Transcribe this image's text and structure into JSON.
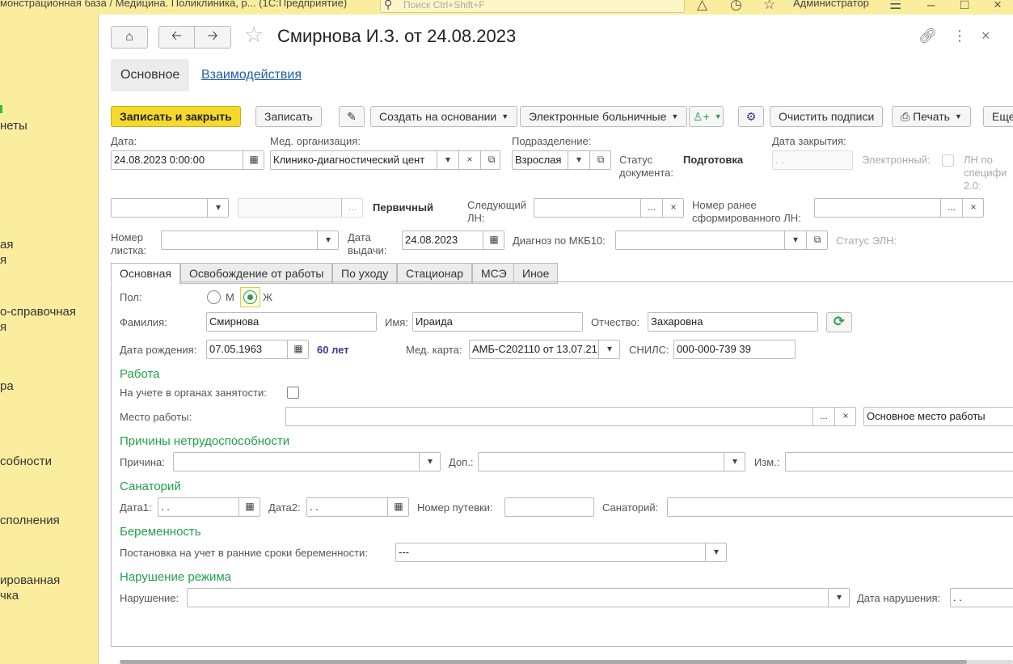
{
  "titlebar": {
    "app_title": "монстрационная база / Медицина. Поликлиника, р... (1С:Предприятие)",
    "search_placeholder": "Поиск Ctrl+Shift+F",
    "user": "Администратор"
  },
  "sidebar": {
    "items": [
      "неты",
      "ая\nя",
      "о-справочная\nя",
      "ра",
      "собности",
      "сполнения",
      "ированная\nчка"
    ]
  },
  "header": {
    "title": "Смирнова И.З. от 24.08.2023"
  },
  "page_tabs": [
    {
      "label": "Основное"
    },
    {
      "label": "Взаимодействия"
    }
  ],
  "toolbar": {
    "save_close": "Записать и закрыть",
    "save": "Записать",
    "create_based": "Создать на основании",
    "sick_leaves": "Электронные больничные",
    "clear_signatures": "Очистить подписи",
    "print": "Печать",
    "more": "Еще"
  },
  "top_fields": {
    "date_label": "Дата:",
    "date_value": "24.08.2023  0:00:00",
    "med_org_label": "Мед. организация:",
    "med_org_value": "Клинико-диагностический цент",
    "division_label": "Подразделение:",
    "division_value": "Взрослая",
    "doc_status_label": "Статус\nдокумента:",
    "doc_status_value": "Подготовка",
    "close_date_label": "Дата закрытия:",
    "close_date_value": " . .",
    "electronic_label": "Электронный:",
    "ln_spec_label": "ЛН по\nспецифи\n2.0:",
    "primary_text": "Первичный",
    "next_ln_label": "Следующий\nЛН:",
    "prev_number_label": "Номер ранее\nсформированного ЛН:",
    "sheet_number_label": "Номер\nлистка:",
    "issue_date_label": "Дата\nвыдачи:",
    "issue_date_value": "24.08.2023",
    "diagnosis_label": "Диагноз по МКБ10:",
    "eln_status_label": "Статус ЭЛН:"
  },
  "inner_tabs": [
    {
      "label": "Основная"
    },
    {
      "label": "Освобождение от работы"
    },
    {
      "label": "По уходу"
    },
    {
      "label": "Стационар"
    },
    {
      "label": "МСЭ"
    },
    {
      "label": "Иное"
    }
  ],
  "patient": {
    "sex_label": "Пол:",
    "sex_m": "М",
    "sex_f": "Ж",
    "surname_label": "Фамилия:",
    "surname_value": "Смирнова",
    "name_label": "Имя:",
    "name_value": "Ираида",
    "patronymic_label": "Отчество:",
    "patronymic_value": "Захаровна",
    "birth_label": "Дата рождения:",
    "birth_value": "07.05.1963",
    "age": "60 лет",
    "med_card_label": "Мед. карта:",
    "med_card_value": "АМБ-С202110 от 13.07.21.",
    "snils_label": "СНИЛС:",
    "snils_value": "000-000-739 39"
  },
  "work": {
    "section": "Работа",
    "employment_label": "На учете в органах занятости:",
    "workplace_label": "Место работы:",
    "workplace_type": "Основное место работы"
  },
  "causes": {
    "section": "Причины нетрудоспособности",
    "reason_label": "Причина:",
    "add_label": "Доп.:",
    "change_label": "Изм.:"
  },
  "sanatorium": {
    "section": "Санаторий",
    "date1_label": "Дата1:",
    "date1_value": " . .",
    "date2_label": "Дата2:",
    "date2_value": " . .",
    "voucher_label": "Номер путевки:",
    "sanatorium_label": "Санаторий:"
  },
  "pregnancy": {
    "section": "Беременность",
    "early_label": "Постановка на учет в ранние сроки беременности:",
    "early_value": "---"
  },
  "violation": {
    "section": "Нарушение режима",
    "violation_label": "Нарушение:",
    "violation_date_label": "Дата нарушения:",
    "violation_date_value": " . ."
  }
}
